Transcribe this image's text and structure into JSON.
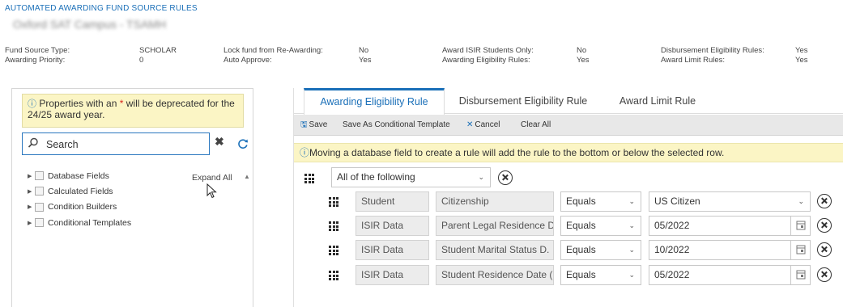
{
  "page": {
    "title": "AUTOMATED AWARDING FUND SOURCE RULES",
    "campus_name": "Oxford SAT Campus - TSAMH"
  },
  "properties": [
    {
      "label": "Fund Source Type:",
      "value": "SCHOLAR"
    },
    {
      "label": "Awarding Priority:",
      "value": "0"
    },
    {
      "label": "Lock fund from Re-Awarding:",
      "value": "No"
    },
    {
      "label": "Auto Approve:",
      "value": "Yes"
    },
    {
      "label": "Award ISIR Students Only:",
      "value": "No"
    },
    {
      "label": "Awarding Eligibility Rules:",
      "value": "Yes"
    },
    {
      "label": "Disbursement Eligibility Rules:",
      "value": "Yes"
    },
    {
      "label": "Award Limit Rules:",
      "value": "Yes"
    }
  ],
  "left_panel": {
    "note_before": "Properties with an ",
    "note_star": "*",
    "note_after": " will be deprecated for the 24/25 award year.",
    "search_placeholder": "Search",
    "expand_all": "Expand All",
    "tree": [
      {
        "label": "Database Fields"
      },
      {
        "label": "Calculated Fields"
      },
      {
        "label": "Condition Builders"
      },
      {
        "label": "Conditional Templates"
      }
    ]
  },
  "tabs": [
    {
      "label": "Awarding Eligibility Rule",
      "active": true
    },
    {
      "label": "Disbursement Eligibility Rule",
      "active": false
    },
    {
      "label": "Award Limit Rule",
      "active": false
    }
  ],
  "toolbar": {
    "save": "Save",
    "save_template": "Save As Conditional Template",
    "cancel": "Cancel",
    "clear_all": "Clear All"
  },
  "info_message": "Moving a database field to create a rule will add the rule to the bottom or below the selected row.",
  "rule_group": {
    "operator": "All of the following"
  },
  "rules": [
    {
      "source": "Student",
      "field": "Citizenship",
      "comparison": "Equals",
      "value": "US Citizen",
      "value_type": "select"
    },
    {
      "source": "ISIR Data",
      "field": "Parent Legal Residence D",
      "comparison": "Equals",
      "value": "05/2022",
      "value_type": "date"
    },
    {
      "source": "ISIR Data",
      "field": "Student Marital Status D.",
      "comparison": "Equals",
      "value": "10/2022",
      "value_type": "date"
    },
    {
      "source": "ISIR Data",
      "field": "Student Residence Date (",
      "comparison": "Equals",
      "value": "05/2022",
      "value_type": "date"
    }
  ],
  "colors": {
    "accent": "#1a6fb8",
    "note_background": "#fbf5c5",
    "required_star": "#d9261c"
  }
}
